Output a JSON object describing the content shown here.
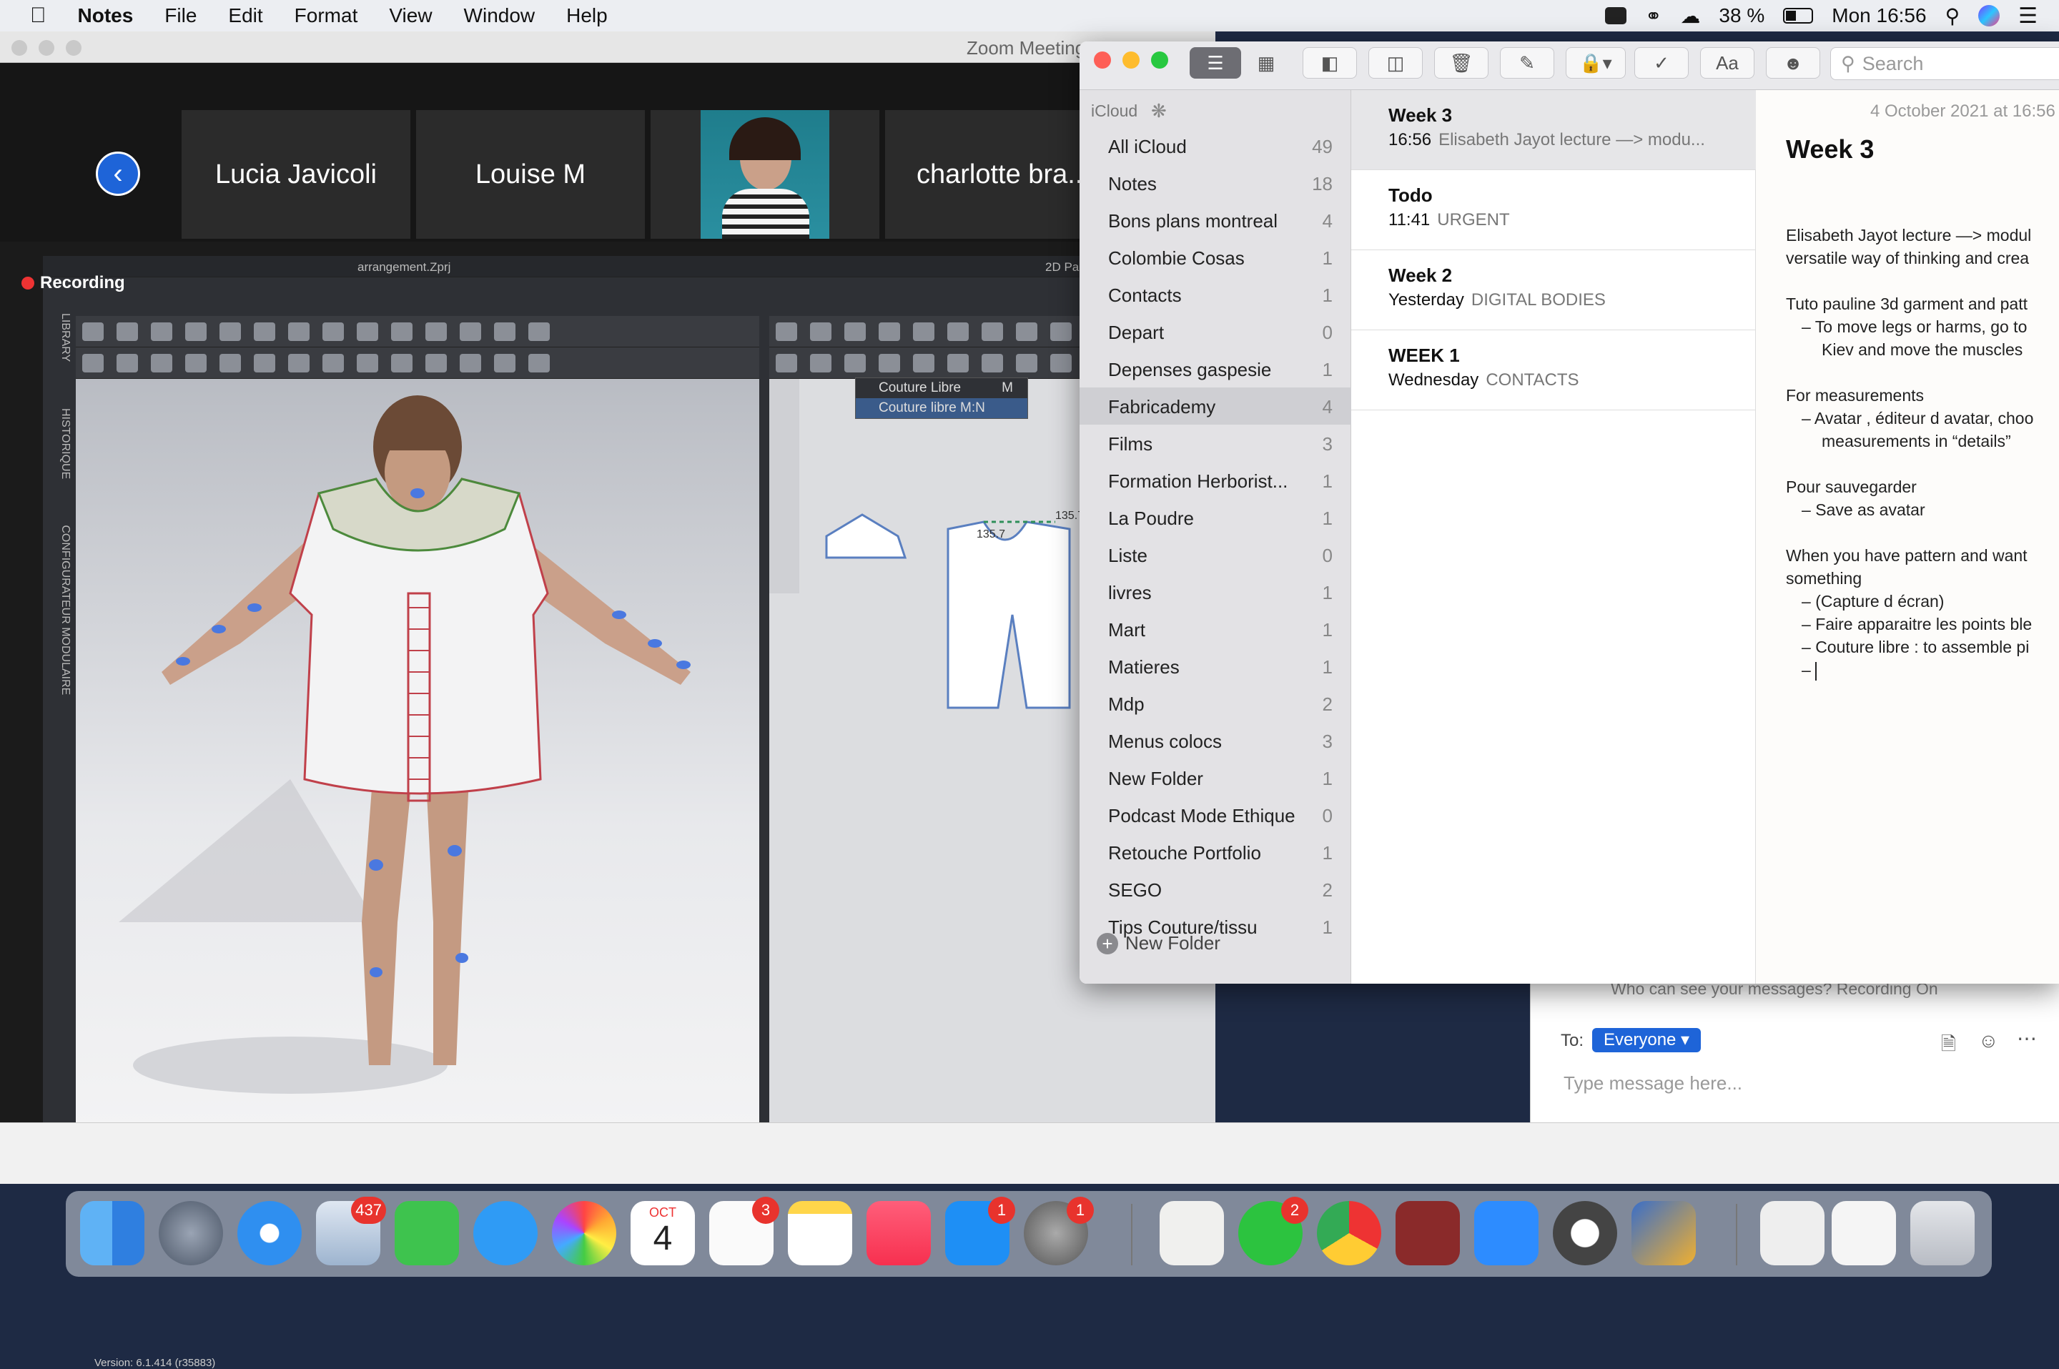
{
  "menubar": {
    "app_name": "Notes",
    "menus": [
      "File",
      "Edit",
      "Format",
      "View",
      "Window",
      "Help"
    ],
    "battery": "38 %",
    "clock": "Mon 16:56"
  },
  "zoom": {
    "window_title": "Zoom Meeting",
    "participants": [
      "Lucia Javicoli",
      "Louise M",
      "charlotte bra..."
    ],
    "recording_label": "Recording",
    "clo_project": "arrangement.Zprj",
    "clo_2d_label": "2D Pa",
    "side_tabs": [
      "LIBRARY",
      "HISTORIQUE",
      "CONFIGURATEUR MODULAIRE"
    ],
    "context_menu": [
      {
        "label": "Couture Libre",
        "shortcut": "M"
      },
      {
        "label": "Couture libre M:N",
        "shortcut": ""
      }
    ],
    "measure_labels": [
      "135.7",
      "135.7"
    ],
    "version": "Version: 6.1.414 (r35883)"
  },
  "chat": {
    "notice": "Who can see your messages? Recording On",
    "to_label": "To:",
    "to_value": "Everyone",
    "placeholder": "Type message here..."
  },
  "notes": {
    "search_placeholder": "Search",
    "sidebar_header": "iCloud",
    "folders": [
      {
        "name": "All iCloud",
        "count": "49"
      },
      {
        "name": "Notes",
        "count": "18"
      },
      {
        "name": "Bons plans montreal",
        "count": "4"
      },
      {
        "name": "Colombie Cosas",
        "count": "1"
      },
      {
        "name": "Contacts",
        "count": "1"
      },
      {
        "name": "Depart",
        "count": "0"
      },
      {
        "name": "Depenses gaspesie",
        "count": "1"
      },
      {
        "name": "Fabricademy",
        "count": "4"
      },
      {
        "name": "Films",
        "count": "3"
      },
      {
        "name": "Formation Herborist...",
        "count": "1"
      },
      {
        "name": "La Poudre",
        "count": "1"
      },
      {
        "name": "Liste",
        "count": "0"
      },
      {
        "name": "livres",
        "count": "1"
      },
      {
        "name": "Mart",
        "count": "1"
      },
      {
        "name": "Matieres",
        "count": "1"
      },
      {
        "name": "Mdp",
        "count": "2"
      },
      {
        "name": "Menus colocs",
        "count": "3"
      },
      {
        "name": "New Folder",
        "count": "1"
      },
      {
        "name": "Podcast Mode Ethique",
        "count": "0"
      },
      {
        "name": "Retouche Portfolio",
        "count": "1"
      },
      {
        "name": "SEGO",
        "count": "2"
      },
      {
        "name": "Tips Couture/tissu",
        "count": "1"
      }
    ],
    "new_folder_label": "New Folder",
    "list": [
      {
        "title": "Week 3",
        "time": "16:56",
        "preview": "Elisabeth Jayot lecture —> modu..."
      },
      {
        "title": "Todo",
        "time": "11:41",
        "preview": "URGENT"
      },
      {
        "title": "Week 2",
        "time": "Yesterday",
        "preview": "DIGITAL BODIES"
      },
      {
        "title": "WEEK 1",
        "time": "Wednesday",
        "preview": "CONTACTS"
      }
    ],
    "note": {
      "date": "4 October 2021 at 16:56",
      "title": "Week 3",
      "lines": [
        "Elisabeth Jayot lecture —> modul",
        "versatile way of thinking and crea",
        "Tuto pauline 3d garment and patt",
        "To move legs or harms, go to",
        "Kiev and move the muscles",
        "For measurements",
        "Avatar , éditeur d avatar, choo",
        "measurements in “details”",
        "Pour sauvegarder",
        "Save as avatar",
        "When you have pattern and want",
        "something",
        "(Capture d écran)",
        "Faire apparaitre les points ble",
        "Couture libre : to assemble pi"
      ]
    }
  },
  "dock": {
    "badges": {
      "mail": "437",
      "appstore": "1",
      "prefs": "1",
      "reminders": "3",
      "whatsapp": "2"
    },
    "calendar_month": "OCT",
    "calendar_day": "4"
  }
}
